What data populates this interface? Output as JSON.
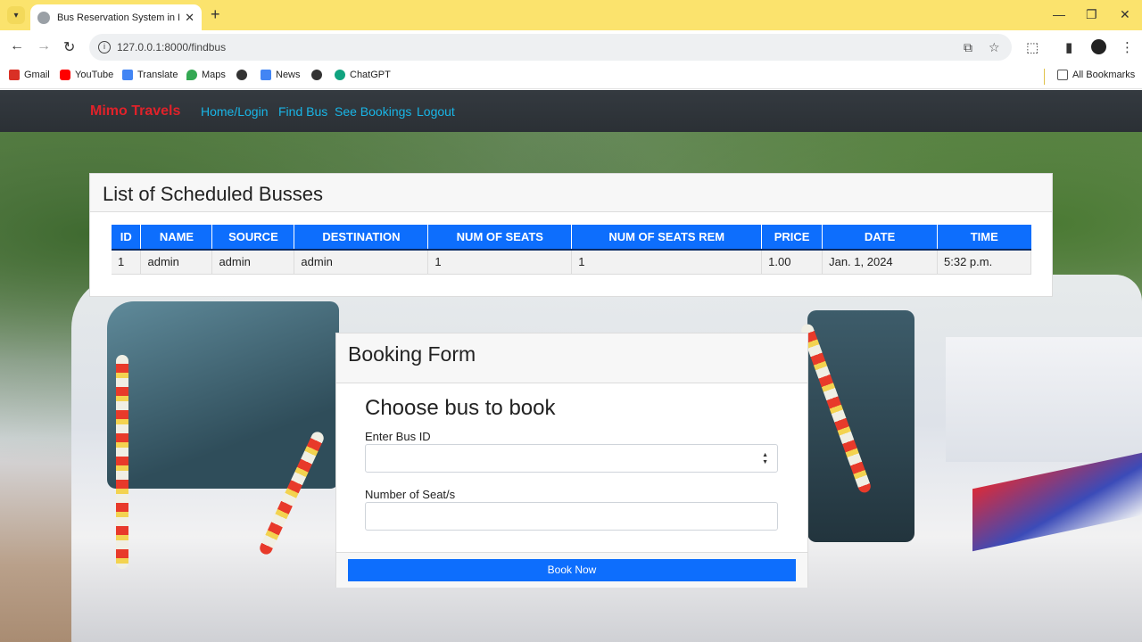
{
  "browser": {
    "tab_title": "Bus Reservation System in Djan",
    "url": "127.0.0.1:8000/findbus",
    "bookmarks": [
      {
        "label": "Gmail",
        "icon": "gmail-icon",
        "color": "#d93025"
      },
      {
        "label": "YouTube",
        "icon": "youtube-icon",
        "color": "#ff0000"
      },
      {
        "label": "Translate",
        "icon": "translate-icon",
        "color": "#4285f4"
      },
      {
        "label": "Maps",
        "icon": "maps-icon",
        "color": "#34a853"
      },
      {
        "label": "",
        "icon": "globe-icon",
        "color": "#333333"
      },
      {
        "label": "News",
        "icon": "news-icon",
        "color": "#4285f4"
      },
      {
        "label": "",
        "icon": "globe-icon",
        "color": "#333333"
      },
      {
        "label": "ChatGPT",
        "icon": "chatgpt-icon",
        "color": "#10a37f"
      }
    ],
    "all_bookmarks": "All Bookmarks"
  },
  "navbar": {
    "brand": "Mimo Travels",
    "links": [
      "Home/Login",
      "Find Bus",
      "See Bookings",
      "Logout"
    ],
    "brand_color": "#e0222a",
    "link_color": "#19b5e6"
  },
  "schedule": {
    "title": "List of Scheduled Busses",
    "columns": [
      "ID",
      "NAME",
      "SOURCE",
      "DESTINATION",
      "NUM OF SEATS",
      "NUM OF SEATS REM",
      "PRICE",
      "DATE",
      "TIME"
    ],
    "rows": [
      [
        "1",
        "admin",
        "admin",
        "admin",
        "1",
        "1",
        "1.00",
        "Jan. 1, 2024",
        "5:32 p.m."
      ]
    ],
    "header_color": "#0d6efd"
  },
  "booking": {
    "header": "Booking Form",
    "title": "Choose bus to book",
    "bus_id_label": "Enter Bus ID",
    "bus_id_value": "",
    "seats_label": "Number of Seat/s",
    "seats_value": "",
    "submit_label": "Book Now",
    "button_color": "#0d6efd"
  }
}
